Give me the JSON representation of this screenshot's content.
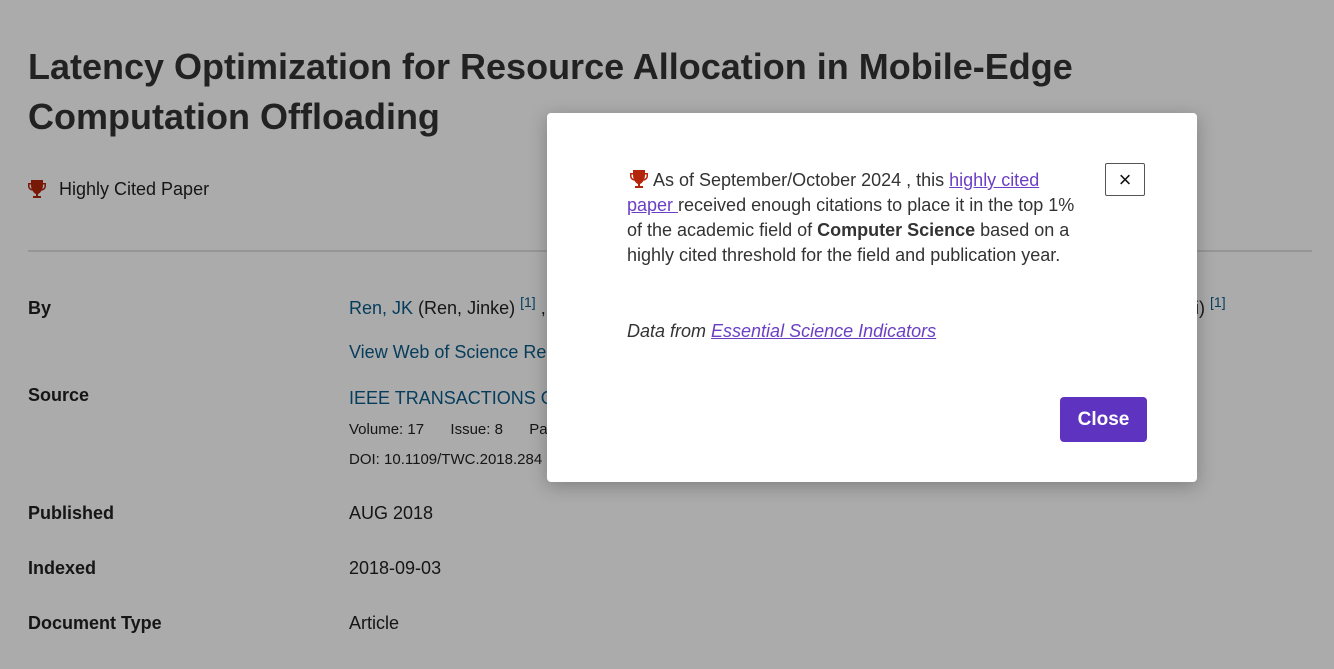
{
  "record": {
    "title": "Latency Optimization for Resource Allocation in Mobile-Edge Computation Offloading",
    "badge_label": "Highly Cited Paper",
    "by_label": "By",
    "author_link": "Ren, JK",
    "author_full": "(Ren, Jinke)",
    "author_ref": "[1]",
    "author_sep": ",",
    "author_tail": "i)",
    "author_tail_ref": "[1]",
    "view_results_link": "View Web of Science Re",
    "source_label": "Source",
    "source_link": "IEEE TRANSACTIONS ON",
    "volume_label": "Volume:",
    "volume_value": "17",
    "issue_label": "Issue:",
    "issue_value": "8",
    "pages_cut": "Pa",
    "doi_label": "DOI:",
    "doi_value": "10.1109/TWC.2018.284",
    "published_label": "Published",
    "published_value": "AUG 2018",
    "indexed_label": "Indexed",
    "indexed_value": "2018-09-03",
    "doctype_label": "Document Type",
    "doctype_value": "Article"
  },
  "modal": {
    "text_before_link": "As of September/October 2024 , this ",
    "link_text": "highly cited paper ",
    "text_after_link": "received enough citations to place it in the top 1% of the academic field of ",
    "field_name": "Computer Science",
    "text_end": " based on a highly cited threshold for the field and publication year.",
    "source_prefix": "Data from ",
    "source_link": "Essential Science Indicators",
    "x_label": "×",
    "close_label": "Close"
  },
  "colors": {
    "trophy": "#b3260c",
    "link": "#0a5c8a",
    "modal_link": "#6b3fc4",
    "primary_button": "#5e33bf",
    "overlay": "rgba(0,0,0,0.33)"
  },
  "icons": {
    "badge": "trophy-icon",
    "close": "close-icon"
  }
}
